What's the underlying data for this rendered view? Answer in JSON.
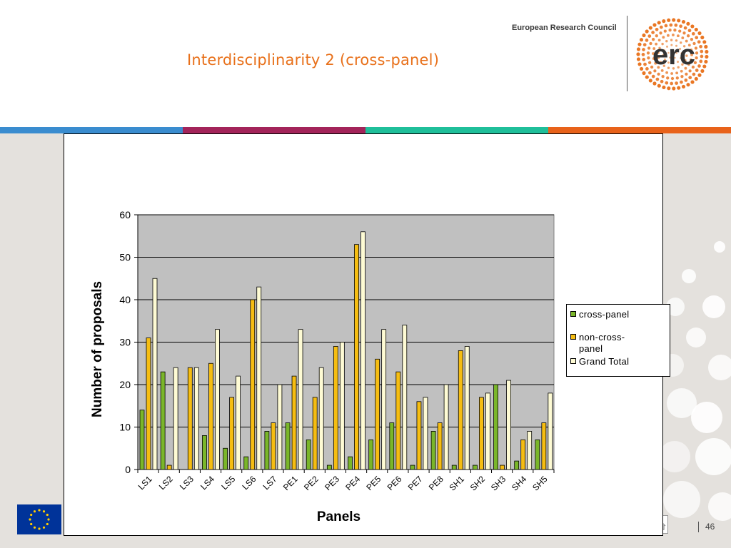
{
  "slide": {
    "title": "Interdisciplinarity 2 (cross-panel)",
    "org_name": "European Research Council",
    "logo_text": "erc",
    "page_number": "46"
  },
  "colors": {
    "title": "#e8701a",
    "stripe": [
      "#3a8ccf",
      "#a3245a",
      "#1fbf9a",
      "#e8621a"
    ],
    "plot_area": "#c0c0c0",
    "logo_dots": "#e8701a",
    "eu_flag": "#003399"
  },
  "chart_data": {
    "type": "bar",
    "xlabel": "Panels",
    "ylabel": "Number of proposals",
    "ylim": [
      0,
      60
    ],
    "yticks": [
      0,
      10,
      20,
      30,
      40,
      50,
      60
    ],
    "grid": true,
    "legend_position": "right",
    "categories": [
      "LS1",
      "LS2",
      "LS3",
      "LS4",
      "LS5",
      "LS6",
      "LS7",
      "PE1",
      "PE2",
      "PE3",
      "PE4",
      "PE5",
      "PE6",
      "PE7",
      "PE8",
      "SH1",
      "SH2",
      "SH3",
      "SH4",
      "SH5"
    ],
    "series": [
      {
        "name": "cross-panel",
        "color": "#7ab62a",
        "values": [
          14,
          23,
          0,
          8,
          5,
          3,
          9,
          11,
          7,
          1,
          3,
          7,
          11,
          1,
          9,
          1,
          1,
          20,
          2,
          7
        ]
      },
      {
        "name": "non-cross-panel",
        "color": "#f5bd12",
        "values": [
          31,
          1,
          24,
          25,
          17,
          40,
          11,
          22,
          17,
          29,
          53,
          26,
          23,
          16,
          11,
          28,
          17,
          1,
          7,
          11
        ]
      },
      {
        "name": "Grand Total",
        "color": "#fefbd4",
        "values": [
          45,
          24,
          24,
          33,
          22,
          43,
          20,
          33,
          24,
          30,
          56,
          33,
          34,
          17,
          20,
          29,
          18,
          21,
          9,
          18
        ]
      }
    ],
    "legend_labels": [
      "cross-panel",
      "non-cross-\npanel",
      "Grand Total"
    ]
  }
}
